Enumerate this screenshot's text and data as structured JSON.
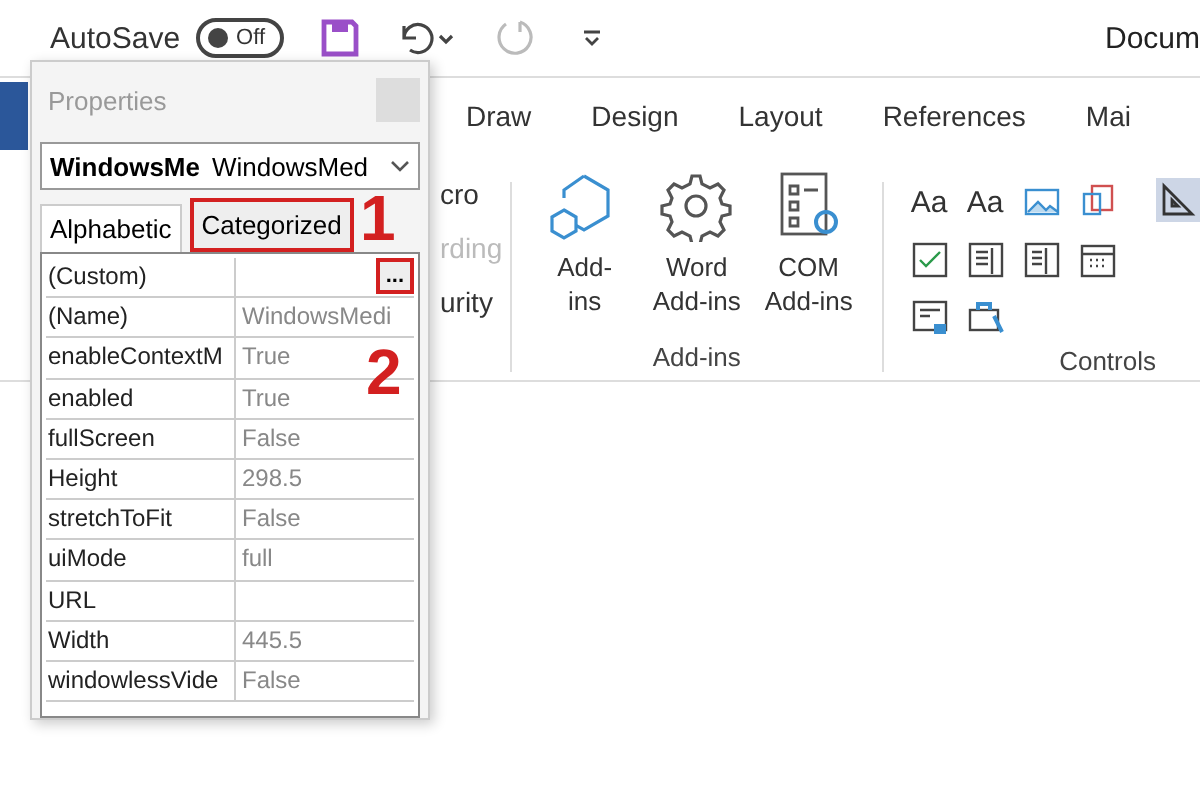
{
  "title_bar": {
    "autosave": {
      "label": "AutoSave",
      "toggle_text": "Off",
      "on": false
    },
    "document_title": "Docum"
  },
  "ribbon_tabs": [
    "Draw",
    "Design",
    "Layout",
    "References",
    "Mai"
  ],
  "ribbon": {
    "macro_items": [
      {
        "label": "cro",
        "disabled": false
      },
      {
        "label": "rding",
        "disabled": true
      },
      {
        "label": "urity",
        "disabled": false
      }
    ],
    "addins_group": {
      "label": "Add-ins",
      "buttons": [
        {
          "kind": "hexagons",
          "label": "Add-\nins"
        },
        {
          "kind": "gear",
          "label": "Word\nAdd-ins"
        },
        {
          "kind": "list",
          "label": "COM\nAdd-ins"
        }
      ]
    },
    "controls_group": {
      "label": "Controls",
      "text_glyphs": [
        "Aa",
        "Aa"
      ]
    }
  },
  "properties": {
    "title": "Properties",
    "object_name": "WindowsMe",
    "object_type": "WindowsMed",
    "tabs": [
      {
        "label": "Alphabetic",
        "selected": true,
        "highlighted": false
      },
      {
        "label": "Categorized",
        "selected": false,
        "highlighted": true
      }
    ],
    "rows": [
      {
        "name": "(Custom)",
        "button": "...",
        "button_highlighted": true
      },
      {
        "name": "(Name)",
        "value": "WindowsMedi"
      },
      {
        "name": "enableContextM",
        "value": "True"
      },
      {
        "name": "enabled",
        "value": "True"
      },
      {
        "name": "fullScreen",
        "value": "False"
      },
      {
        "name": "Height",
        "value": "298.5"
      },
      {
        "name": "stretchToFit",
        "value": "False"
      },
      {
        "name": "uiMode",
        "value": "full"
      },
      {
        "name": "URL"
      },
      {
        "name": "Width",
        "value": "445.5"
      },
      {
        "name": "windowlessVide",
        "value": "False"
      }
    ]
  },
  "annotations": [
    "1",
    "2"
  ]
}
